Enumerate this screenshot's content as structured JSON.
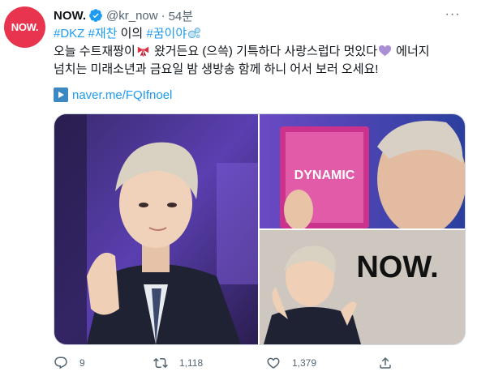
{
  "account": {
    "avatar_text": "NOW.",
    "display_name": "NOW.",
    "handle": "@kr_now",
    "separator": "·",
    "time": "54분"
  },
  "more_label": "···",
  "tweet": {
    "hashtags": [
      "#DKZ",
      "#재찬"
    ],
    "text_after_tags": " 이의 ",
    "hashtag_end": "#꿈이야",
    "line2_a": "오늘 수트재짱이",
    "line2_b": " 왔거든요 (으쓱) 기특하다 사랑스럽다 멋있다",
    "line2_c": " 에너지",
    "line3": "넘치는 미래소년과 금요일 밤 생방송 함께 하니 어서 보러 오세요!"
  },
  "link": {
    "text": "naver.me/FQIfnoel"
  },
  "media": {
    "photo2_sign": "DYNAMIC",
    "photo3_sign": "NOW."
  },
  "actions": {
    "reply_count": "9",
    "retweet_count": "1,118",
    "like_count": "1,379"
  },
  "colors": {
    "brand": "#e8344e",
    "link": "#1d9bf0",
    "secondary_text": "#536471",
    "border": "#cfd9de"
  },
  "icons": [
    "verified-badge-icon",
    "more-icon",
    "ribbon-emoji",
    "heart-emoji",
    "bubbles-emoji",
    "play-button-icon",
    "reply-icon",
    "retweet-icon",
    "like-icon",
    "share-icon"
  ]
}
